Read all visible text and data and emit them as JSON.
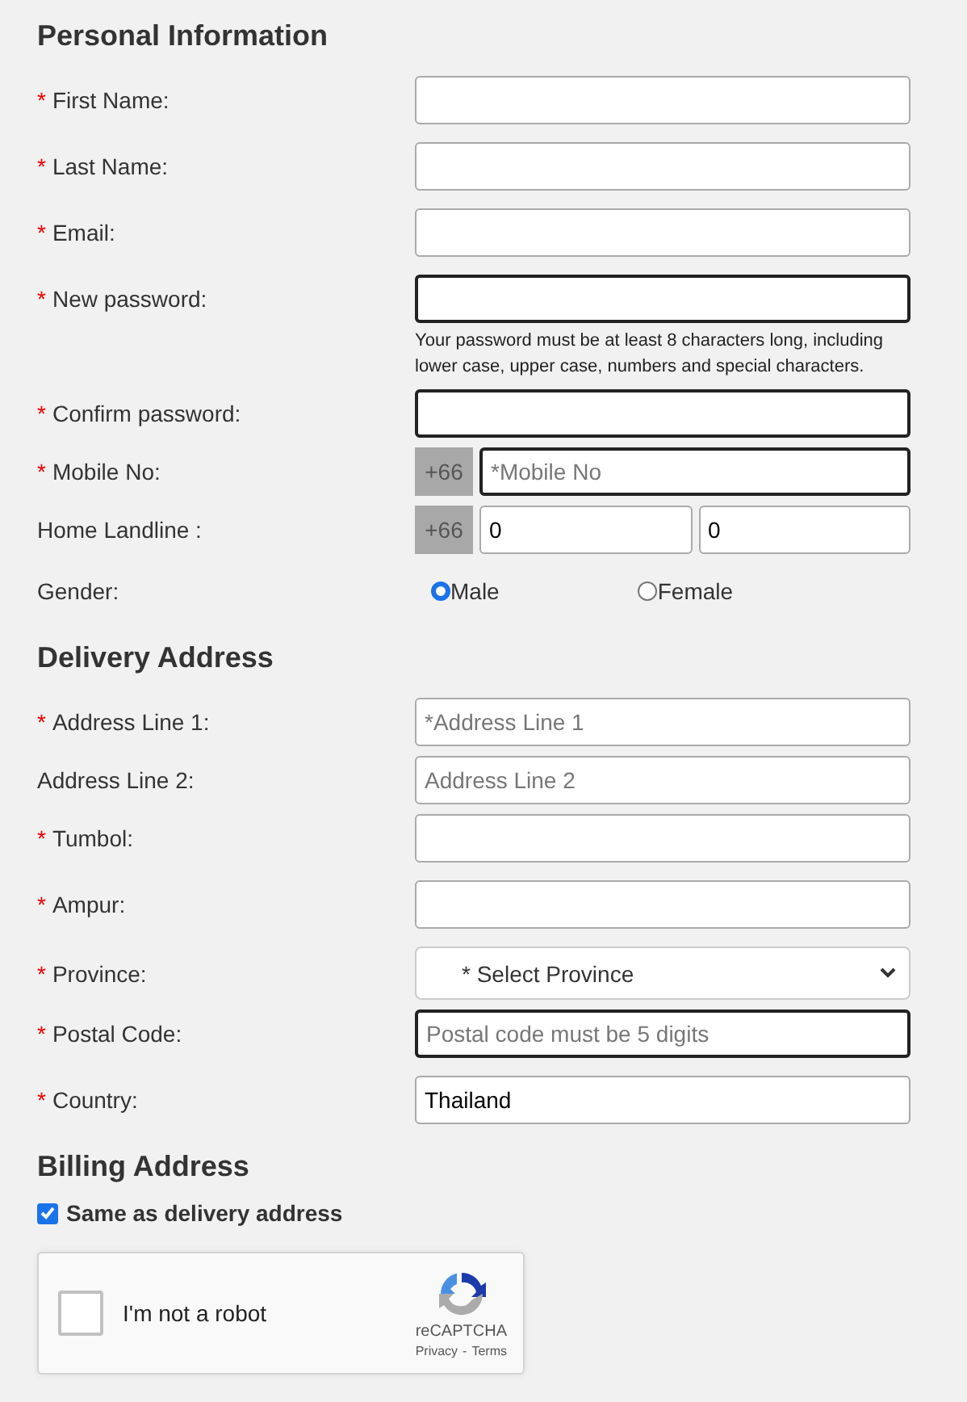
{
  "sections": [
    {
      "title": "Personal Information",
      "rows": [
        {
          "kind": "input",
          "mark": "*",
          "label": "First Name:",
          "highlighted": false
        },
        {
          "kind": "input",
          "mark": "*",
          "label": "Last Name:",
          "highlighted": false
        },
        {
          "kind": "input",
          "mark": "*",
          "label": "Email:",
          "highlighted": false
        },
        {
          "kind": "input",
          "mark": "*",
          "label": "New password:",
          "highlighted": true,
          "hint": "Your password must be at least 8 characters long, including lower case, upper case, numbers and special characters."
        },
        {
          "kind": "input",
          "mark": "*",
          "label": "Confirm password:",
          "highlighted": true
        },
        {
          "kind": "phone",
          "mark": "*",
          "label": "Mobile No:",
          "prefix": "+66",
          "inputs": [
            {
              "placeholder": "*Mobile No",
              "highlighted": true
            }
          ]
        },
        {
          "kind": "phone",
          "label": "Home Landline :",
          "prefix": "+66",
          "inputs": [
            {
              "value": "0",
              "highlighted": false
            },
            {
              "value": "0",
              "highlighted": false
            }
          ]
        },
        {
          "kind": "radio",
          "label": "Gender:",
          "options": [
            {
              "label": "Male",
              "selected": true
            },
            {
              "label": "Female",
              "selected": false
            }
          ]
        }
      ]
    },
    {
      "title": "Delivery Address",
      "rows": [
        {
          "kind": "input",
          "mark": "*",
          "label": "Address Line 1:",
          "placeholder": "*Address Line 1",
          "highlighted": false
        },
        {
          "kind": "input",
          "label": "Address Line 2:",
          "placeholder": "Address Line 2",
          "highlighted": false
        },
        {
          "kind": "input",
          "mark": "*",
          "label": "Tumbol:",
          "highlighted": false
        },
        {
          "kind": "input",
          "mark": "*",
          "label": "Ampur:",
          "highlighted": false
        },
        {
          "kind": "select",
          "mark": "*",
          "label": "Province:",
          "value": "* Select Province"
        },
        {
          "kind": "input",
          "mark": "*",
          "label": "Postal Code:",
          "placeholder": "Postal code must be 5 digits",
          "highlighted": true
        },
        {
          "kind": "input",
          "mark": "*",
          "label": "Country:",
          "value": "Thailand",
          "highlighted": false
        }
      ]
    },
    {
      "title": "Billing Address",
      "rows": [
        {
          "kind": "checkbox",
          "label": "Same as delivery address",
          "checked": true
        }
      ]
    }
  ],
  "captcha": {
    "label": "I'm not a robot",
    "checked": false,
    "brand": "reCAPTCHA",
    "links": [
      "Privacy",
      "Terms"
    ],
    "separator": "-"
  }
}
